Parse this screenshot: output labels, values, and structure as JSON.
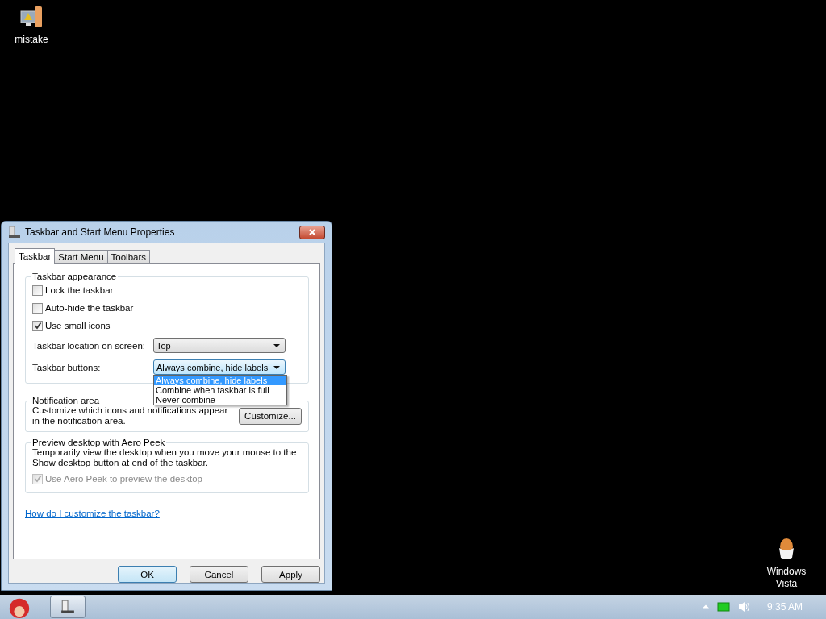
{
  "desktop_icons": [
    {
      "label": "mistake",
      "kind": "computer"
    },
    {
      "label": "Windows Vista",
      "kind": "egg"
    }
  ],
  "window": {
    "title": "Taskbar and Start Menu Properties",
    "tabs": [
      {
        "label": "Taskbar",
        "selected": true
      },
      {
        "label": "Start Menu",
        "selected": false
      },
      {
        "label": "Toolbars",
        "selected": false
      }
    ],
    "appearance": {
      "title": "Taskbar appearance",
      "checkboxes": [
        {
          "label": "Lock the taskbar",
          "checked": false
        },
        {
          "label": "Auto-hide the taskbar",
          "checked": false
        },
        {
          "label": "Use small icons",
          "checked": true
        }
      ],
      "dropdowns": [
        {
          "label": "Taskbar location on screen:",
          "value": "Top",
          "expanded": false
        },
        {
          "label": "Taskbar buttons:",
          "value": "Always combine, hide labels",
          "expanded": true,
          "options": [
            {
              "label": "Always combine, hide labels",
              "selected": true
            },
            {
              "label": "Combine when taskbar is full",
              "selected": false
            },
            {
              "label": "Never combine",
              "selected": false
            }
          ]
        }
      ]
    },
    "notification": {
      "title": "Notification area",
      "text": "Customize which icons and notifications appear in the notification area.",
      "button": "Customize..."
    },
    "peek": {
      "title": "Preview desktop with Aero Peek",
      "text": "Temporarily view the desktop when you move your mouse to the Show desktop button at end of the taskbar.",
      "checkbox": {
        "label": "Use Aero Peek to preview the desktop",
        "checked": true,
        "disabled": true
      }
    },
    "help_link": "How do I customize the taskbar?",
    "buttons": [
      {
        "label": "OK",
        "default": true
      },
      {
        "label": "Cancel",
        "default": false
      },
      {
        "label": "Apply",
        "default": false
      }
    ]
  },
  "taskbar": {
    "clock": "9:35 AM"
  }
}
